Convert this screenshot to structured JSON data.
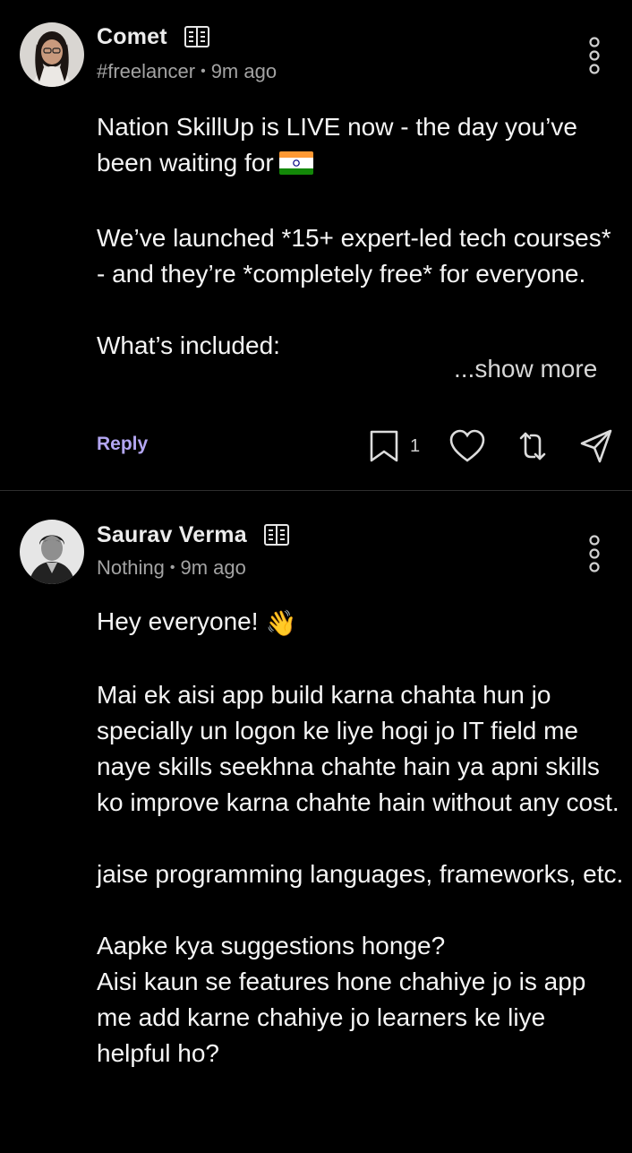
{
  "colors": {
    "background": "#000000",
    "reply_accent": "#b3a6f2",
    "meta_gray": "#a3a3a3",
    "divider": "#2e2e2e"
  },
  "posts": [
    {
      "author": "Comet",
      "handle": "#freelancer",
      "separator": "•",
      "time": "9m ago",
      "company_icon": "company-building-icon",
      "paragraphs": [
        "Nation SkillUp is LIVE now - the day you’ve been waiting for",
        "We’ve launched *15+ expert-led tech courses* - and they’re *completely free* for everyone.",
        "What’s included:"
      ],
      "emoji": "india-flag",
      "show_more": "...show more",
      "actions": {
        "reply": "Reply",
        "comment_count": "1",
        "icons": [
          "comment-icon",
          "heart-icon",
          "repost-icon",
          "share-icon"
        ]
      }
    },
    {
      "author": "Saurav Verma",
      "handle": "Nothing",
      "separator": "•",
      "time": "9m ago",
      "company_icon": "company-building-icon",
      "paragraphs": [
        "Hey everyone!",
        "Mai ek aisi app build karna chahta hun jo specially un logon ke liye hogi jo IT field me naye skills seekhna chahte hain ya apni skills ko improve karna chahte hain without any cost.",
        "jaise programming languages, frameworks, etc.",
        "Aapke kya suggestions honge?",
        "Aisi kaun se features hone chahiye jo is app me add karne chahiye jo learners ke liye helpful ho?"
      ],
      "emoji": "👋"
    }
  ]
}
